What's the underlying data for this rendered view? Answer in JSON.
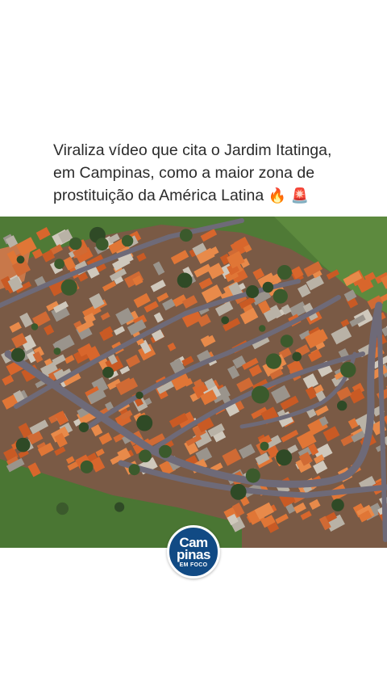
{
  "post": {
    "caption_line1": "Viraliza vídeo que cita o Jardim Itatinga,",
    "caption_line2": "em Campinas, como a maior zona de",
    "caption_line3": "prostituição da América Latina",
    "emoji_fire": "🔥",
    "emoji_siren": "🚨"
  },
  "media": {
    "icon": "aerial-neighborhood-photo"
  },
  "logo": {
    "line1": "Cam",
    "line2": "pinas",
    "line3": "EM FOCO",
    "bg_color": "#114a84"
  },
  "colors": {
    "roof": "#d8662c",
    "road": "#6e6a78",
    "grass": "#4f7a36"
  }
}
